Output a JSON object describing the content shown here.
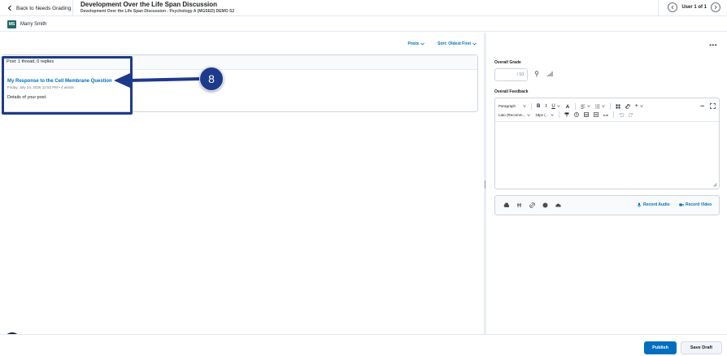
{
  "header": {
    "back_label": "Back to Needs Grading",
    "title": "Development Over the Life Span Discussion",
    "subtitle": "Development Over the Life Span Discussion - Psychology A (MGSED) DEMO S2",
    "user_nav": "User 1 of 1"
  },
  "user": {
    "initials": "MS",
    "name": "Marry Smith"
  },
  "left": {
    "filter_posts": "Posts",
    "sort_label": "Sort: Oldest First",
    "thread_summary": "Post: 1 thread, 0 replies",
    "post": {
      "title": "My Response to the Cell Membrane Question",
      "meta": "Friday, July 24, 2026 12:52 PM  •  4 words",
      "body": "Details of your post."
    },
    "step_number": "8"
  },
  "right": {
    "more": "•••",
    "overall_grade_label": "Overall Grade",
    "grade_value": "",
    "grade_out_of": "/ 10",
    "overall_feedback_label": "Overall Feedback",
    "toolbar": {
      "format": "Paragraph",
      "font": "Lato (Recomm...",
      "size": "19px (...",
      "more_label": "•••",
      "special": "sub"
    },
    "record_audio": "Record Audio",
    "record_video": "Record Video"
  },
  "footer": {
    "publish": "Publish",
    "save_draft": "Save Draft"
  },
  "colors": {
    "accent": "#006fbf",
    "callout": "#1e3a8a",
    "avatar": "#1f6b5f"
  }
}
